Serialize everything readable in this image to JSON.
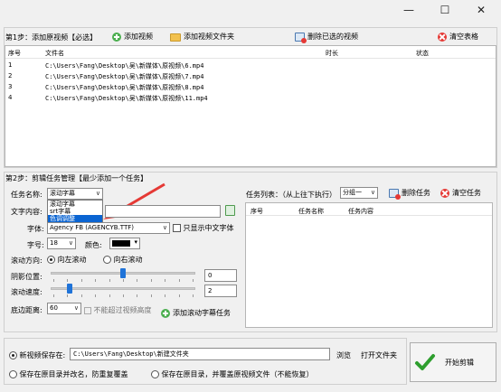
{
  "window": {
    "minimize": "—",
    "maximize": "☐",
    "close": "✕"
  },
  "step1": {
    "label": "第1步：添加原视频【必选】",
    "add_video": "添加视频",
    "add_folder": "添加视频文件夹",
    "delete_selected": "删除已选的视频",
    "clear_table": "清空表格",
    "columns": [
      "序号",
      "文件名",
      "时长",
      "状态"
    ],
    "rows": [
      {
        "index": "1",
        "file": "C:\\Users\\Fang\\Desktop\\吴\\新媒体\\原视频\\6.mp4",
        "duration": "",
        "status": ""
      },
      {
        "index": "2",
        "file": "C:\\Users\\Fang\\Desktop\\吴\\新媒体\\原视频\\7.mp4",
        "duration": "",
        "status": ""
      },
      {
        "index": "3",
        "file": "C:\\Users\\Fang\\Desktop\\吴\\新媒体\\原视频\\8.mp4",
        "duration": "",
        "status": ""
      },
      {
        "index": "4",
        "file": "C:\\Users\\Fang\\Desktop\\吴\\新媒体\\原视频\\11.mp4",
        "duration": "",
        "status": ""
      }
    ]
  },
  "step2": {
    "label": "第2步：剪辑任务管理【最少添加一个任务】",
    "task_name_label": "任务名称:",
    "task_name_value": "滚动字幕",
    "task_name_options": [
      "滚动字幕",
      "srt字幕",
      "色调调整"
    ],
    "task_name_highlighted": "色调调整",
    "text_content_label": "文字内容:",
    "font_label": "字体:",
    "font_value": "Agency FB (AGENCYB.TTF)",
    "only_chinese_label": "只显示中文字体",
    "size_label": "字号:",
    "size_value": "18",
    "color_label": "颜色:",
    "scroll_dir_label": "滚动方向:",
    "scroll_left": "向左滚动",
    "scroll_right": "向右滚动",
    "shadow_label": "阴影位置:",
    "shadow_value": "0",
    "shadow_level": 0.5,
    "speed_label": "滚动速度:",
    "speed_value": "2",
    "speed_level": 0.12,
    "bottom_label": "底边距离:",
    "bottom_value": "60",
    "bottom_hint": "不能超过视频高度",
    "add_task": "添加滚动字幕任务",
    "task_list_label": "任务列表：（从上往下执行）",
    "group_value": "分组一",
    "delete_task": "删除任务",
    "clear_task": "清空任务",
    "task_columns": [
      "序号",
      "任务名称",
      "任务内容"
    ]
  },
  "output": {
    "save_new_label": "新视频保存在:",
    "save_path": "C:\\Users\\Fang\\Desktop\\新建文件夹",
    "browse": "浏览",
    "open_folder": "打开文件夹",
    "save_rename": "保存在原目录并改名，防重复覆盖",
    "save_overwrite": "保存在原目录，并覆盖原视频文件（不能恢复）",
    "start": "开始剪辑"
  },
  "colors": {
    "arrow": "#e53935",
    "accent": "#0a64d2",
    "selection": "#0a64d2"
  }
}
